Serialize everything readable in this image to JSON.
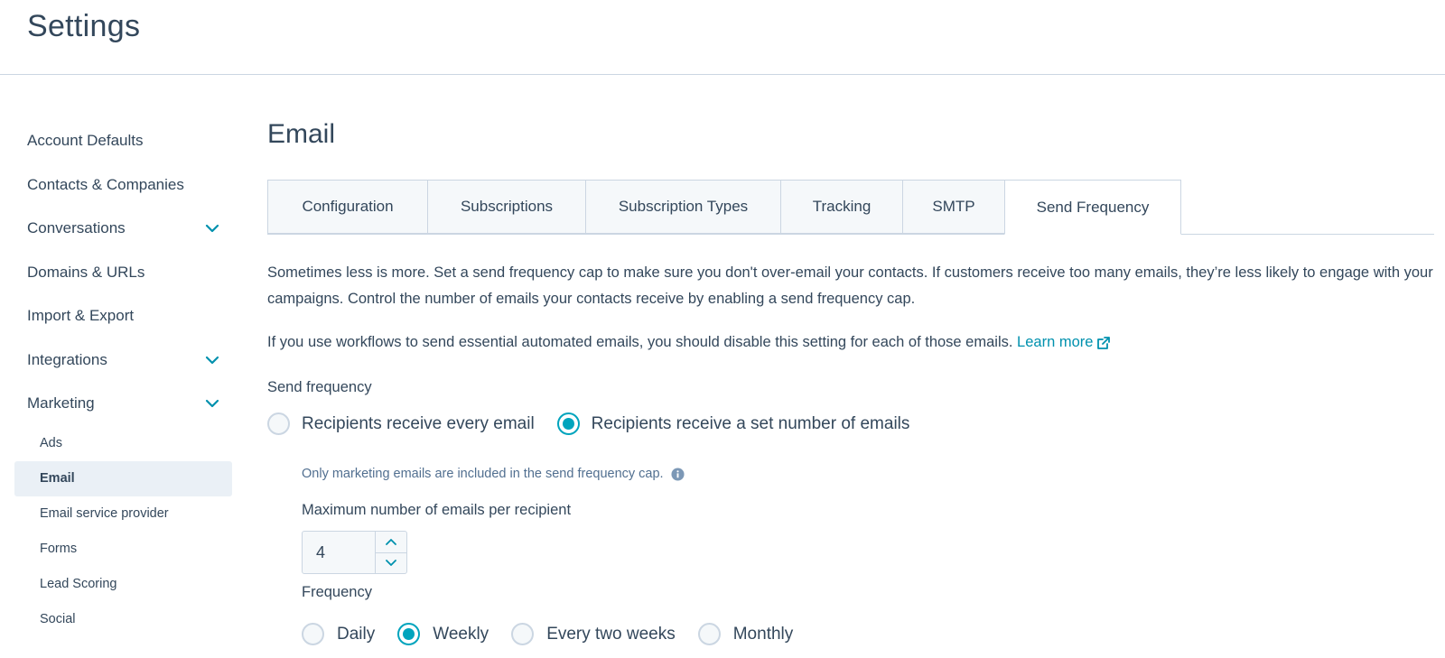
{
  "header": {
    "title": "Settings"
  },
  "sidebar": {
    "items": [
      {
        "label": "Account Defaults",
        "expandable": false
      },
      {
        "label": "Contacts & Companies",
        "expandable": false
      },
      {
        "label": "Conversations",
        "expandable": true
      },
      {
        "label": "Domains & URLs",
        "expandable": false
      },
      {
        "label": "Import & Export",
        "expandable": false
      },
      {
        "label": "Integrations",
        "expandable": true
      },
      {
        "label": "Marketing",
        "expandable": true
      }
    ],
    "marketing_sub": [
      "Ads",
      "Email",
      "Email service provider",
      "Forms",
      "Lead Scoring",
      "Social"
    ],
    "active_sub": "Email"
  },
  "main": {
    "title": "Email",
    "tabs": [
      "Configuration",
      "Subscriptions",
      "Subscription Types",
      "Tracking",
      "SMTP",
      "Send Frequency"
    ],
    "active_tab": "Send Frequency",
    "description_1": "Sometimes less is more. Set a send frequency cap to make sure you don't over-email your contacts. If customers receive too many emails, they’re less likely to engage with your campaigns. Control the number of emails your contacts receive by enabling a send frequency cap.",
    "description_2": "If you use workflows to send essential automated emails, you should disable this setting for each of those emails.",
    "learn_more": "Learn more",
    "send_frequency": {
      "label": "Send frequency",
      "options": [
        "Recipients receive every email",
        "Recipients receive a set number of emails"
      ],
      "selected": "Recipients receive a set number of emails"
    },
    "note": "Only marketing emails are included in the send frequency cap.",
    "max_emails": {
      "label": "Maximum number of emails per recipient",
      "value": "4"
    },
    "frequency": {
      "label": "Frequency",
      "options": [
        "Daily",
        "Weekly",
        "Every two weeks",
        "Monthly"
      ],
      "selected": "Weekly"
    }
  },
  "colors": {
    "accent": "#00a4bd",
    "link": "#0091ae",
    "text": "#33475b",
    "border": "#cbd6e2",
    "active_bg": "#eaf0f6"
  },
  "icons": {
    "chevron": "chevron-down-icon",
    "external": "external-link-icon",
    "info": "info-icon"
  }
}
